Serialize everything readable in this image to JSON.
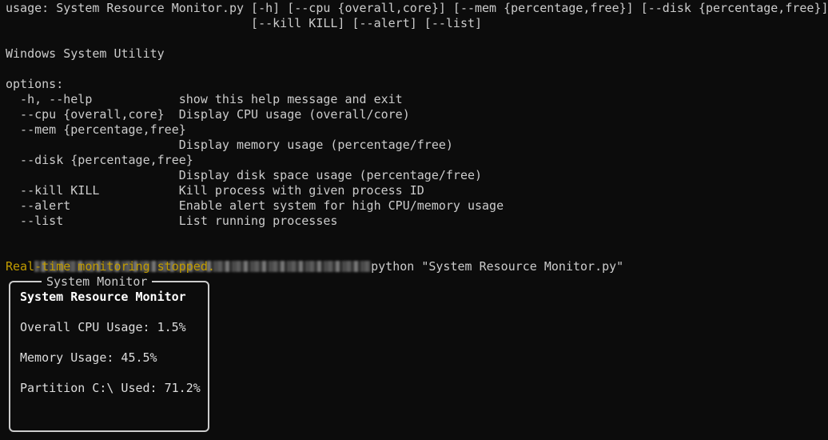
{
  "terminal": {
    "usage_line_1": "usage: System Resource Monitor.py [-h] [--cpu {overall,core}] [--mem {percentage,free}] [--disk {percentage,free}]",
    "usage_line_2": "                                  [--kill KILL] [--alert] [--list]",
    "description": "Windows System Utility",
    "options_header": "options:",
    "options": [
      {
        "text": "  -h, --help            show this help message and exit"
      },
      {
        "text": "  --cpu {overall,core}  Display CPU usage (overall/core)"
      },
      {
        "text": "  --mem {percentage,free}"
      },
      {
        "text": "                        Display memory usage (percentage/free)"
      },
      {
        "text": "  --disk {percentage,free}"
      },
      {
        "text": "                        Display disk space usage (percentage/free)"
      },
      {
        "text": "  --kill KILL           Kill process with given process ID"
      },
      {
        "text": "  --alert               Enable alert system for high CPU/memory usage"
      },
      {
        "text": "  --list                List running processes"
      }
    ],
    "command": "python \"System Resource Monitor.py\"",
    "stopped_message": "Real-time monitoring stopped."
  },
  "monitor": {
    "frame_title": "System Monitor",
    "heading": "System Resource Monitor",
    "cpu": "Overall CPU Usage: 1.5%",
    "memory": "Memory Usage: 45.5%",
    "partition": "Partition C:\\ Used: 71.2%"
  },
  "colors": {
    "background": "#0c0c0c",
    "text": "#cccccc",
    "warning": "#c19c00"
  }
}
